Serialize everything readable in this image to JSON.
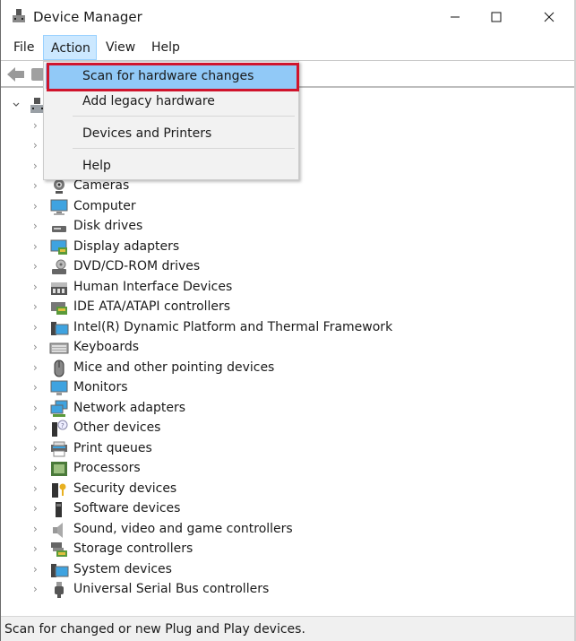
{
  "window": {
    "title": "Device Manager",
    "controls": {
      "minimize": "minimize",
      "maximize": "maximize",
      "close": "close"
    }
  },
  "menubar": {
    "items": [
      {
        "label": "File"
      },
      {
        "label": "Action",
        "active": true
      },
      {
        "label": "View"
      },
      {
        "label": "Help"
      }
    ]
  },
  "action_menu": {
    "items": [
      {
        "label": "Scan for hardware changes",
        "highlighted": true
      },
      {
        "label": "Add legacy hardware"
      },
      {
        "label": "Devices and Printers"
      },
      {
        "label": "Help"
      }
    ]
  },
  "highlight_color": "#d0142c",
  "tree": {
    "root": {
      "label": "",
      "expanded": true
    },
    "hidden_rows": 3,
    "categories": [
      {
        "label": "Cameras",
        "icon": "camera-icon"
      },
      {
        "label": "Computer",
        "icon": "computer-icon"
      },
      {
        "label": "Disk drives",
        "icon": "disk-drive-icon"
      },
      {
        "label": "Display adapters",
        "icon": "display-adapter-icon"
      },
      {
        "label": "DVD/CD-ROM drives",
        "icon": "dvd-drive-icon"
      },
      {
        "label": "Human Interface Devices",
        "icon": "hid-icon"
      },
      {
        "label": "IDE ATA/ATAPI controllers",
        "icon": "ide-controller-icon"
      },
      {
        "label": "Intel(R) Dynamic Platform and Thermal Framework",
        "icon": "intel-dptf-icon"
      },
      {
        "label": "Keyboards",
        "icon": "keyboard-icon"
      },
      {
        "label": "Mice and other pointing devices",
        "icon": "mouse-icon"
      },
      {
        "label": "Monitors",
        "icon": "monitor-icon"
      },
      {
        "label": "Network adapters",
        "icon": "network-adapter-icon"
      },
      {
        "label": "Other devices",
        "icon": "other-devices-icon"
      },
      {
        "label": "Print queues",
        "icon": "printer-icon"
      },
      {
        "label": "Processors",
        "icon": "processor-icon"
      },
      {
        "label": "Security devices",
        "icon": "security-device-icon"
      },
      {
        "label": "Software devices",
        "icon": "software-device-icon"
      },
      {
        "label": "Sound, video and game controllers",
        "icon": "speaker-icon"
      },
      {
        "label": "Storage controllers",
        "icon": "storage-controller-icon"
      },
      {
        "label": "System devices",
        "icon": "system-devices-icon"
      },
      {
        "label": "Universal Serial Bus controllers",
        "icon": "usb-icon"
      }
    ]
  },
  "statusbar": {
    "text": "Scan for changed or new Plug and Play devices."
  }
}
